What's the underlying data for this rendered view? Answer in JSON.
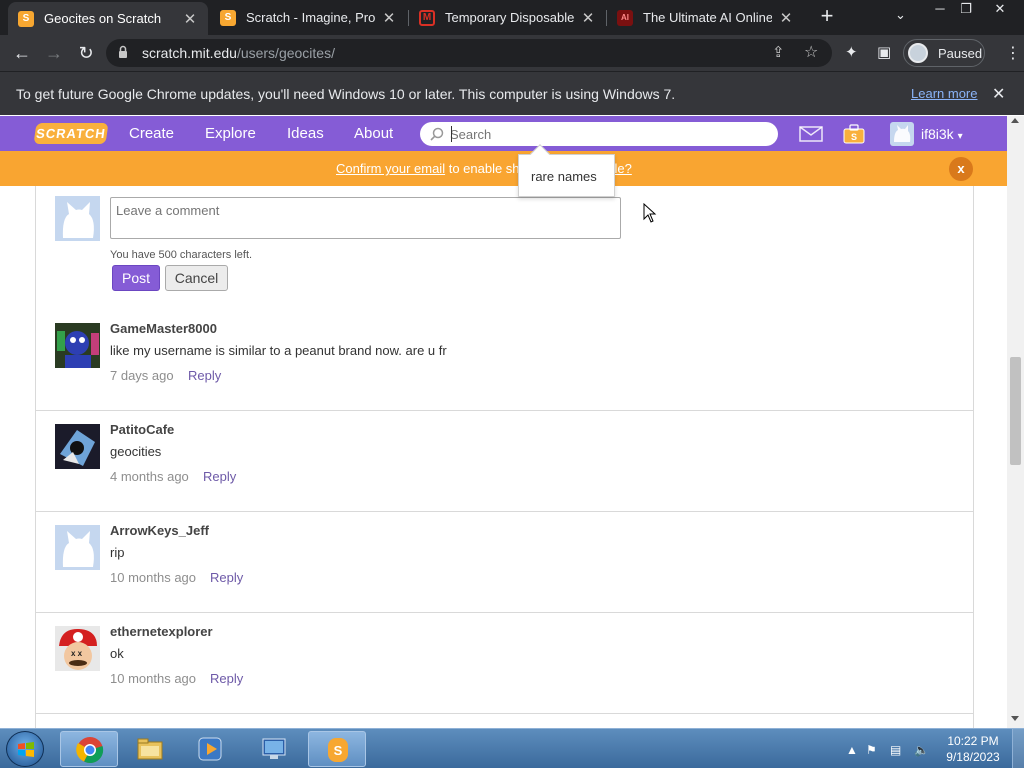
{
  "browser": {
    "tabs": [
      {
        "title": "Geocites on Scratch",
        "favicon": "scratch-favicon",
        "active": true
      },
      {
        "title": "Scratch - Imagine, Progra",
        "favicon": "scratch-favicon",
        "active": false
      },
      {
        "title": "Temporary Disposable Gr",
        "favicon": "mail-favicon",
        "active": false
      },
      {
        "title": "The Ultimate AI Online To",
        "favicon": "ai-favicon",
        "active": false
      }
    ],
    "url_host": "scratch.mit.edu",
    "url_path": "/users/geocites/",
    "profile_label": "Paused",
    "update_notice": "To get future Google Chrome updates, you'll need Windows 10 or later. This computer is using Windows 7.",
    "learn_more": "Learn more"
  },
  "scratch_nav": {
    "logo": "SCRATCH",
    "links": [
      "Create",
      "Explore",
      "Ideas",
      "About"
    ],
    "search_placeholder": "Search",
    "username": "if8i3k"
  },
  "confirm_banner": {
    "link": "Confirm your email",
    "text": " to enable sh",
    "trailing_link": "uble?",
    "close": "x"
  },
  "search_suggestion": "rare names",
  "comment_form": {
    "placeholder": "Leave a comment",
    "chars_left": "You have 500 characters left.",
    "post": "Post",
    "cancel": "Cancel"
  },
  "comments": [
    {
      "user": "GameMaster8000",
      "text": "like my username is similar to a peanut brand now. are u fr",
      "time": "7 days ago",
      "reply": "Reply"
    },
    {
      "user": "PatitoCafe",
      "text": "geocities",
      "time": "4 months ago",
      "reply": "Reply"
    },
    {
      "user": "ArrowKeys_Jeff",
      "text": "rip",
      "time": "10 months ago",
      "reply": "Reply"
    },
    {
      "user": "ethernetexplorer",
      "text": "ok",
      "time": "10 months ago",
      "reply": "Reply"
    }
  ],
  "taskbar": {
    "time": "10:22 PM",
    "date": "9/18/2023"
  },
  "colors": {
    "scratch_purple": "#855cd6",
    "banner_orange": "#f9a531",
    "chrome_dark": "#202124"
  }
}
